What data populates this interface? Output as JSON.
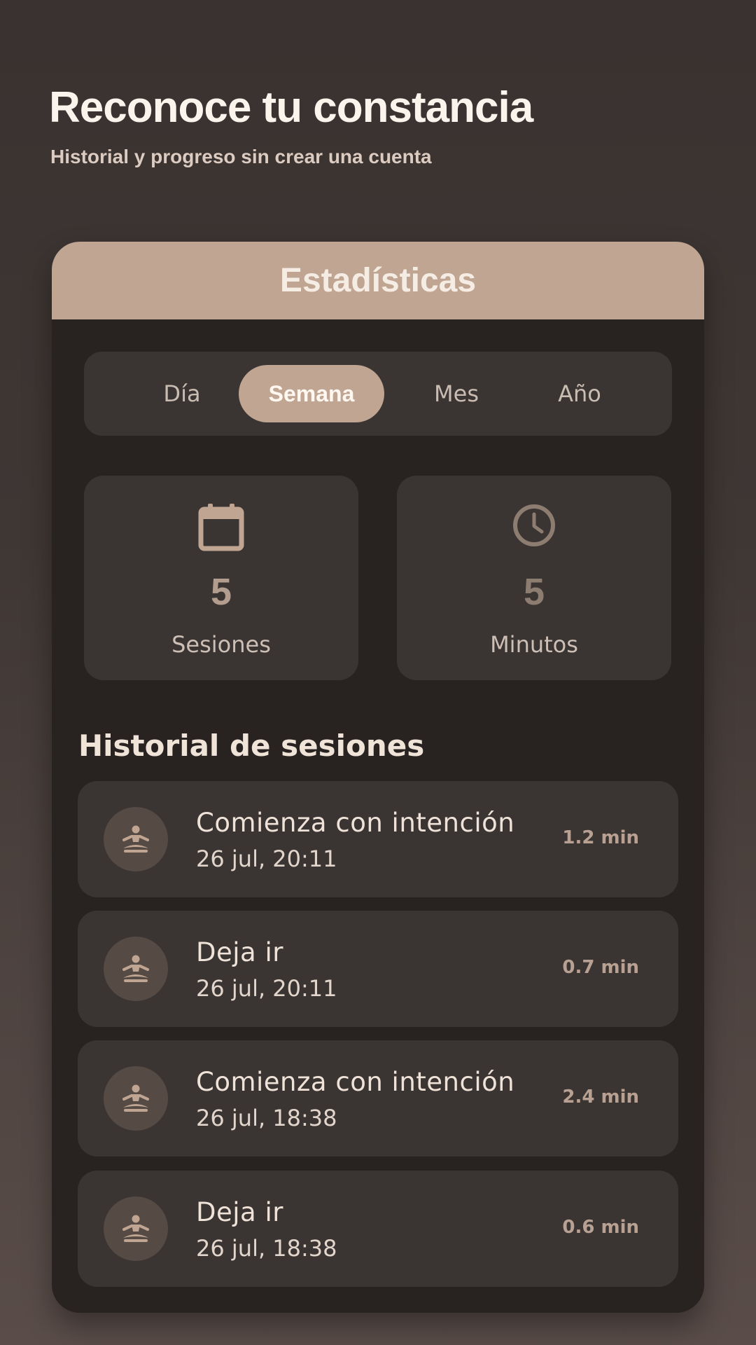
{
  "hero": {
    "title": "Reconoce tu constancia",
    "subtitle": "Historial y progreso sin crear una cuenta"
  },
  "card": {
    "header_title": "Estadísticas",
    "tabs": [
      {
        "label": "Día",
        "active": false
      },
      {
        "label": "Semana",
        "active": true
      },
      {
        "label": "Mes",
        "active": false
      },
      {
        "label": "Año",
        "active": false
      }
    ],
    "stats": [
      {
        "icon": "calendar-icon",
        "value": "5",
        "label": "Sesiones"
      },
      {
        "icon": "clock-icon",
        "value": "5",
        "label": "Minutos"
      }
    ],
    "history_title": "Historial de sesiones",
    "sessions": [
      {
        "icon": "meditation-icon",
        "title": "Comienza con intención",
        "date": "26 jul, 20:11",
        "duration": "1.2 min"
      },
      {
        "icon": "meditation-icon",
        "title": "Deja ir",
        "date": "26 jul, 20:11",
        "duration": "0.7 min"
      },
      {
        "icon": "meditation-icon",
        "title": "Comienza con intención",
        "date": "26 jul, 18:38",
        "duration": "2.4 min"
      },
      {
        "icon": "meditation-icon",
        "title": "Deja ir",
        "date": "26 jul, 18:38",
        "duration": "0.6 min"
      }
    ]
  },
  "colors": {
    "accent": "#bfa592",
    "background": "#393230",
    "card": "#282321",
    "surface": "#3a3532"
  }
}
